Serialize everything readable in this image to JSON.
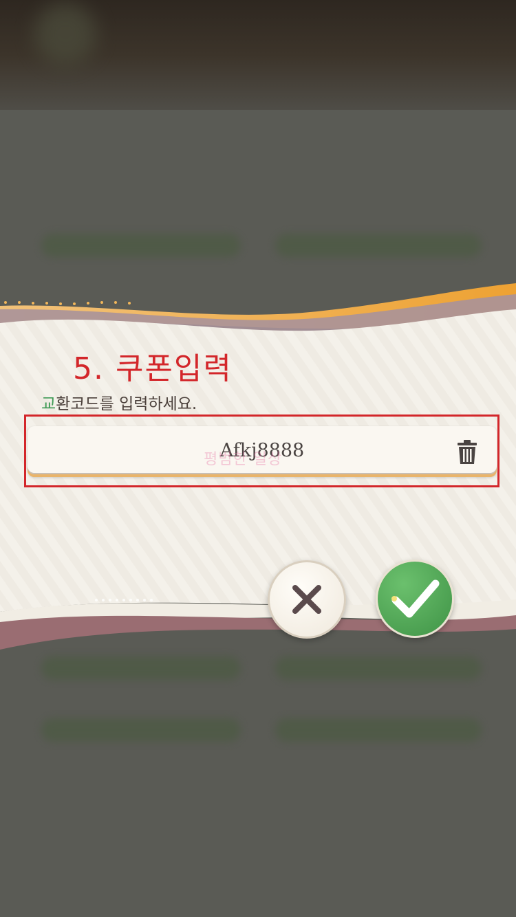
{
  "annotation": {
    "step_title": "5. 쿠폰입력"
  },
  "dialog": {
    "prompt_first_char": "교",
    "prompt_rest": "환코드를 입력하세요.",
    "code_input": {
      "value": "Afkj8888"
    },
    "watermark": "평범한 일상"
  },
  "colors": {
    "annotation_red": "#d3262a",
    "accent_green": "#3f9a55",
    "accent_orange": "#e9a43a"
  },
  "icons": {
    "clear": "trash-icon",
    "cancel": "close-icon",
    "confirm": "checkmark-icon"
  }
}
